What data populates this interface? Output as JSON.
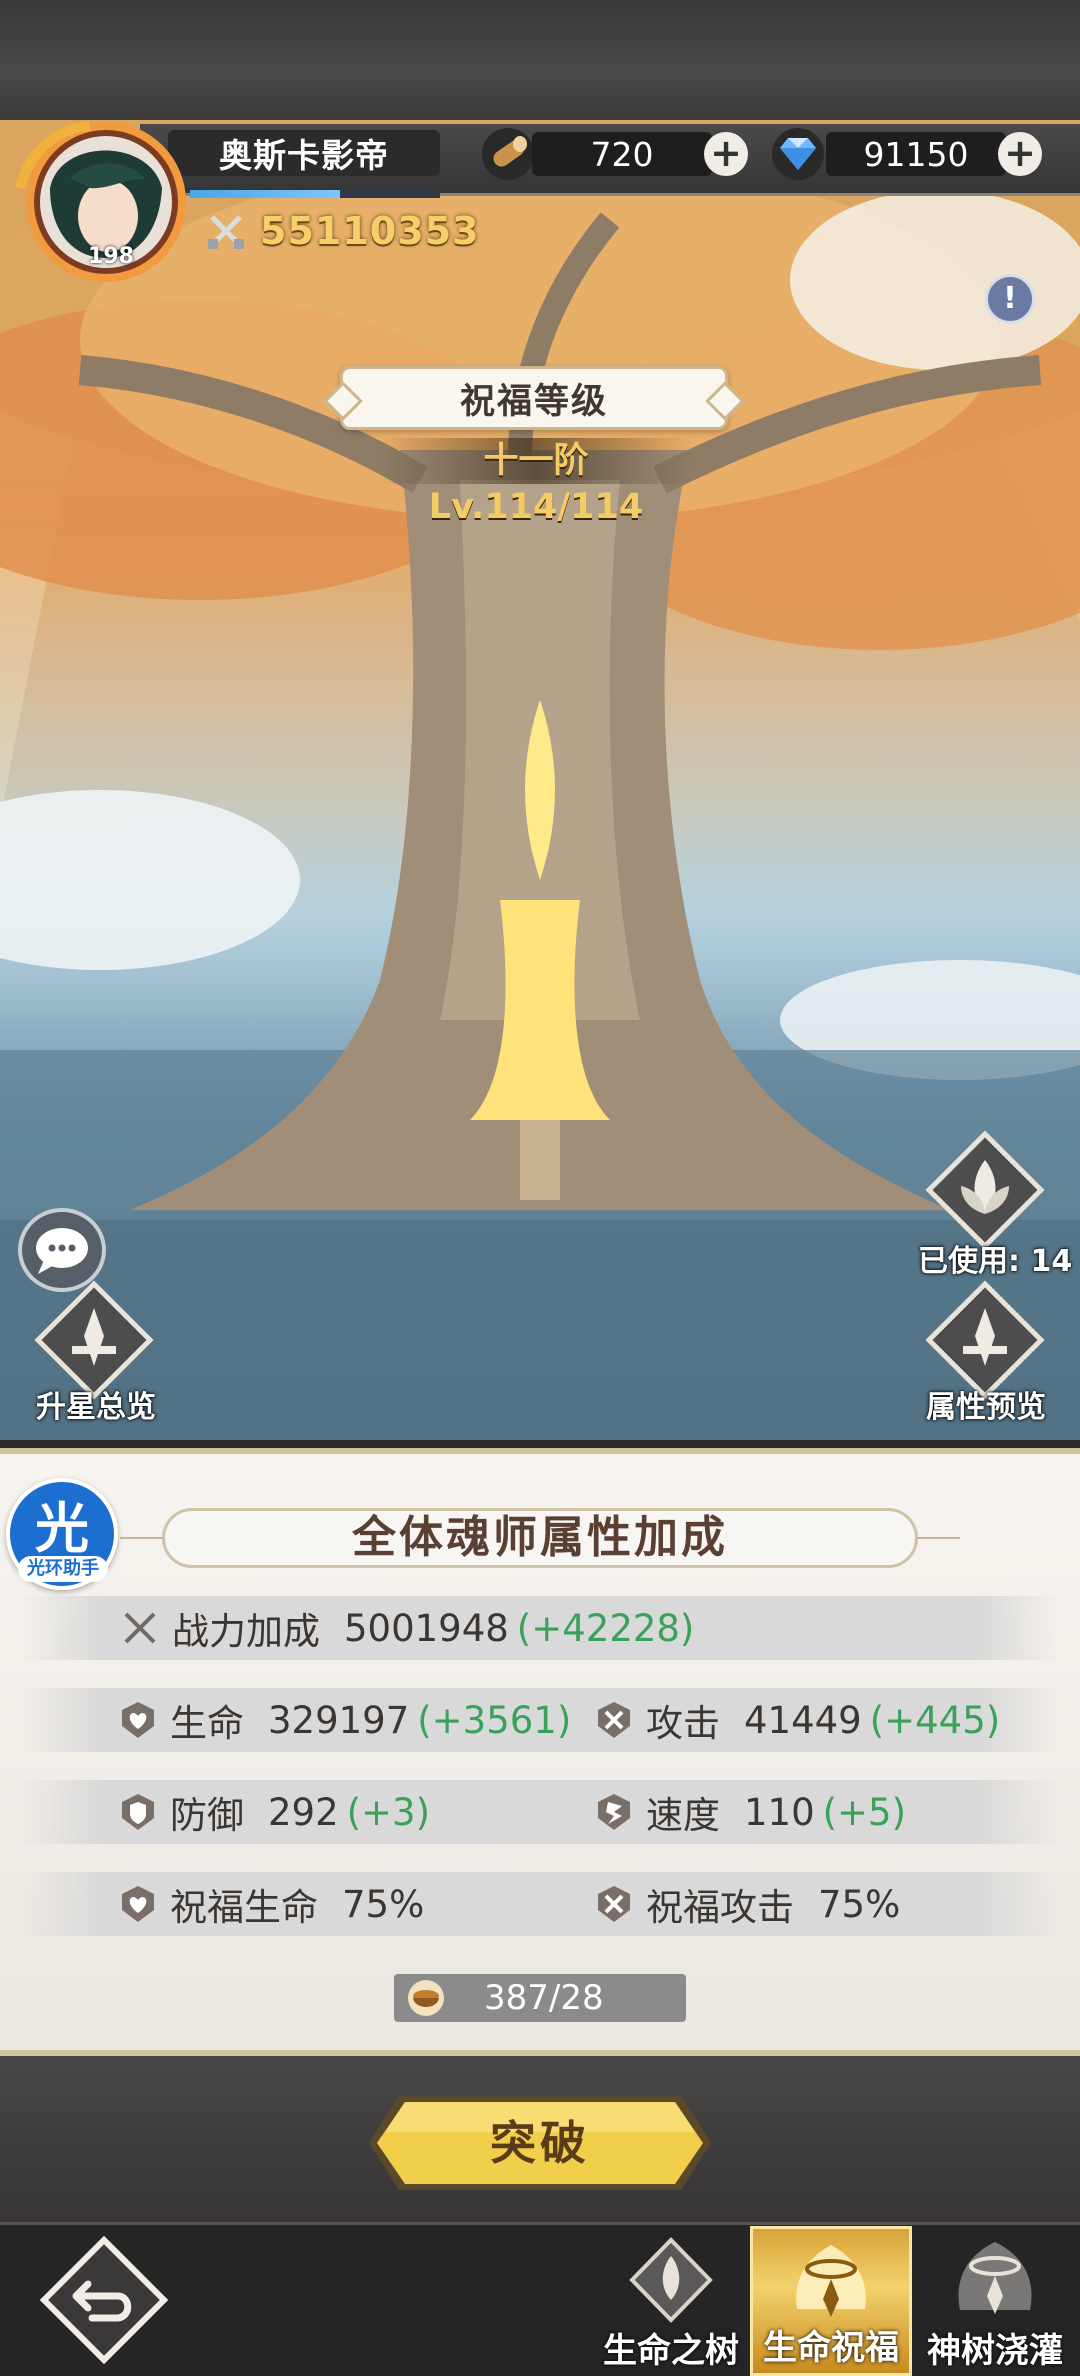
{
  "player": {
    "name": "奥斯卡影帝",
    "level": "198",
    "power": "55110353",
    "exp_fill": 0.6
  },
  "resources": [
    {
      "icon": "wood-log-icon",
      "value": "720"
    },
    {
      "icon": "diamond-icon",
      "value": "91150"
    }
  ],
  "blessing": {
    "title": "祝福等级",
    "tier": "十一阶 Lv.114/114"
  },
  "side_buttons": {
    "used": "已使用: 14",
    "star_overview": "升星总览",
    "attribute_preview": "属性预览"
  },
  "panel": {
    "title": "全体魂师属性加成",
    "helper_glyph": "光",
    "helper_label": "光环助手",
    "combat": {
      "label": "战力加成",
      "value": "5001948",
      "bonus": "(+42228)"
    },
    "stats": [
      {
        "icon": "heart-shield-icon",
        "label": "生命",
        "value": "329197",
        "bonus": "(+3561)"
      },
      {
        "icon": "swords-shield-icon",
        "label": "攻击",
        "value": "41449",
        "bonus": "(+445)"
      },
      {
        "icon": "shield-icon",
        "label": "防御",
        "value": "292",
        "bonus": "(+3)"
      },
      {
        "icon": "speed-shield-icon",
        "label": "速度",
        "value": "110",
        "bonus": "(+5)"
      },
      {
        "icon": "heart-shield-icon",
        "label": "祝福生命",
        "value": "75%",
        "bonus": ""
      },
      {
        "icon": "swords-shield-icon",
        "label": "祝福攻击",
        "value": "75%",
        "bonus": ""
      }
    ],
    "material": "387/28"
  },
  "actions": {
    "breakthrough": "突破"
  },
  "tabs": [
    {
      "label": "生命之树",
      "active": false
    },
    {
      "label": "生命祝福",
      "active": true
    },
    {
      "label": "神树浇灌",
      "active": false
    }
  ],
  "colors": {
    "bonus_green": "#3aa158",
    "gold": "#f6cf6a",
    "button_yellow": "#f2cf4a"
  }
}
